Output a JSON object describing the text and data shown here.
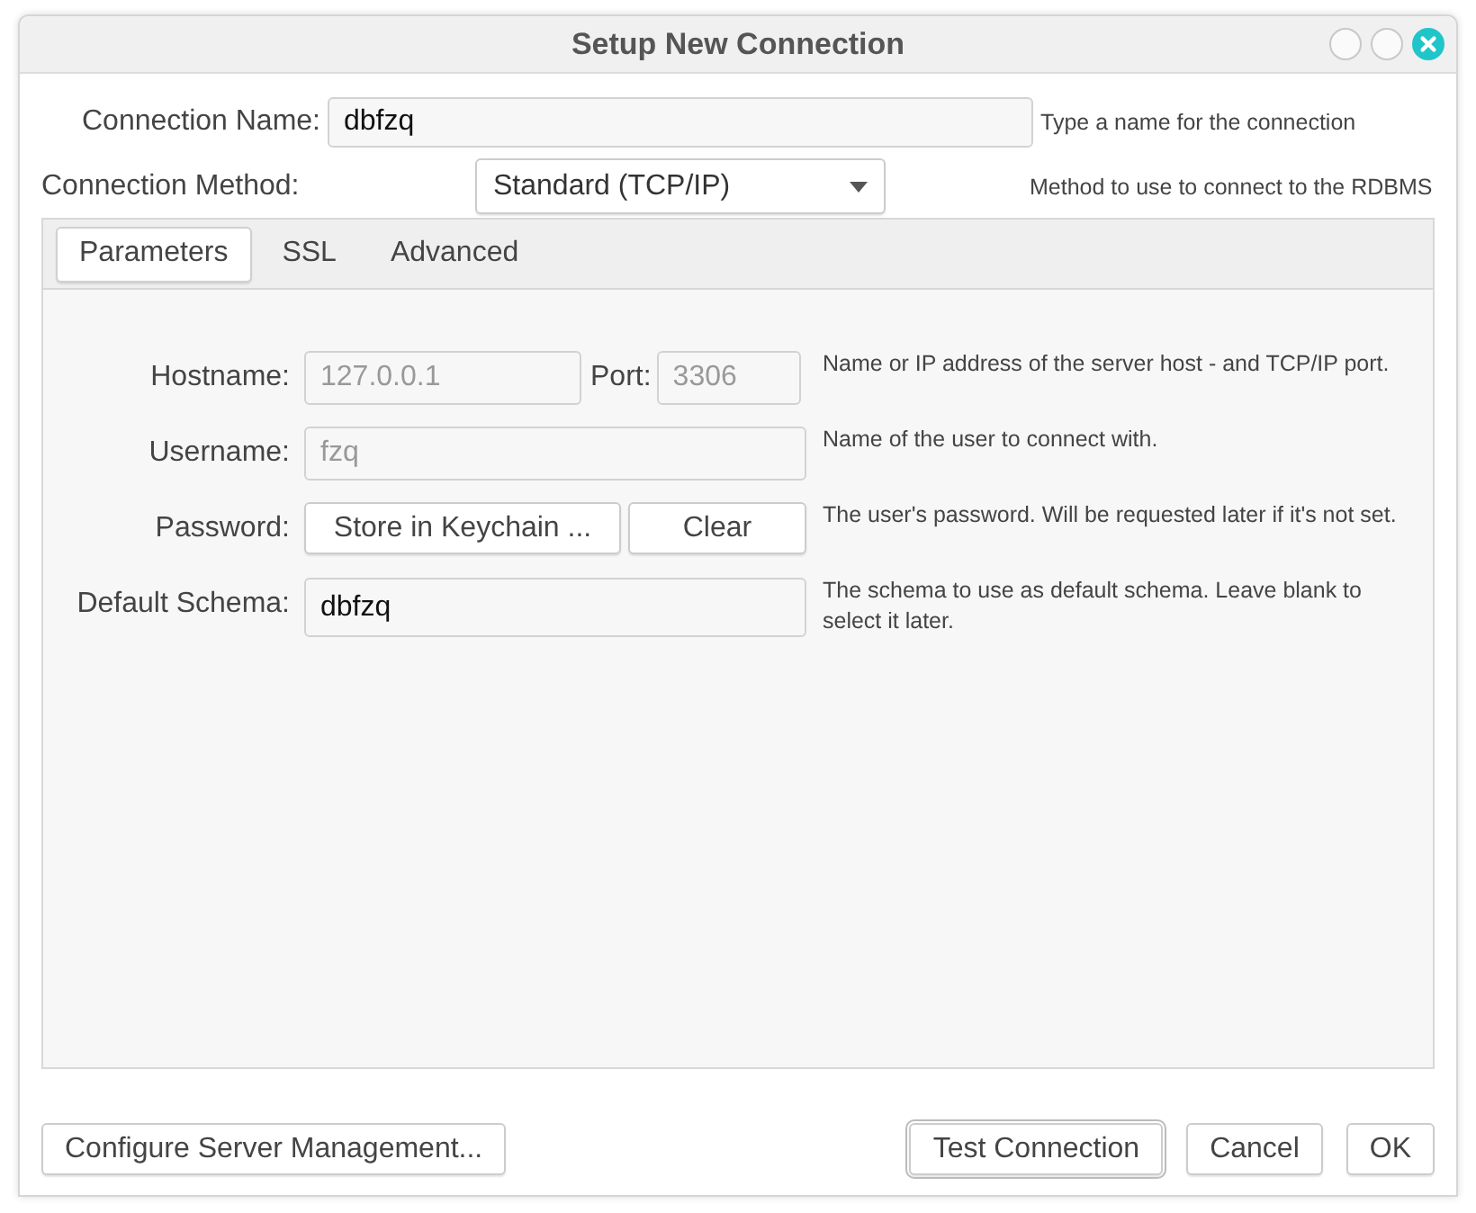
{
  "window": {
    "title": "Setup New Connection"
  },
  "connection_name": {
    "label": "Connection Name:",
    "value": "dbfzq",
    "hint": "Type a name for the connection"
  },
  "connection_method": {
    "label": "Connection Method:",
    "value": "Standard (TCP/IP)",
    "hint": "Method to use to connect to the RDBMS"
  },
  "tabs": [
    {
      "label": "Parameters",
      "selected": true
    },
    {
      "label": "SSL",
      "selected": false
    },
    {
      "label": "Advanced",
      "selected": false
    }
  ],
  "parameters": [
    {
      "kind": "host",
      "label": "Hostname:",
      "value": "127.0.0.1",
      "disabled": true,
      "port_label": "Port:",
      "port_value": "3306",
      "hint": "Name or IP address of the server host - and TCP/IP port."
    },
    {
      "kind": "text",
      "label": "Username:",
      "value": "fzq",
      "disabled": true,
      "hint": "Name of the user to connect with."
    },
    {
      "kind": "buttons",
      "label": "Password:",
      "buttons": [
        "Store in Keychain ...",
        "Clear"
      ],
      "hint": "The user's password. Will be requested later if it's not set."
    },
    {
      "kind": "text",
      "label": "Default Schema:",
      "value": "dbfzq",
      "disabled": false,
      "hint": "The schema to use as default schema. Leave blank to select it later."
    }
  ],
  "footer": {
    "left_button": "Configure Server Management...",
    "buttons": [
      {
        "label": "Test Connection",
        "default": true
      },
      {
        "label": "Cancel",
        "default": false
      },
      {
        "label": "OK",
        "default": false
      }
    ]
  }
}
